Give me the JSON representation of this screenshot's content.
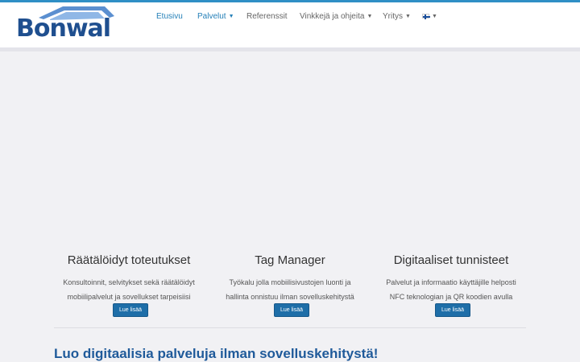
{
  "brand": {
    "logo_text": "Bonwal",
    "accent": "#2f8fc5",
    "logo_color": "#1f4f8f"
  },
  "nav": {
    "items": [
      {
        "label": "Etusivu",
        "active": true,
        "dropdown": false
      },
      {
        "label": "Palvelut",
        "active": true,
        "dropdown": true
      },
      {
        "label": "Referenssit",
        "active": false,
        "dropdown": false
      },
      {
        "label": "Vinkkejä ja ohjeita",
        "active": false,
        "dropdown": true
      },
      {
        "label": "Yritys",
        "active": false,
        "dropdown": true
      }
    ],
    "language": {
      "icon": "finnish-flag-icon",
      "dropdown": true
    }
  },
  "features": [
    {
      "title": "Räätälöidyt toteutukset",
      "line1": "Konsultoinnit, selvitykset sekä räätälöidyt",
      "line2": "mobiilipalvelut ja sovellukset tarpeisiisi",
      "button": "Lue lisää"
    },
    {
      "title": "Tag Manager",
      "line1": "Työkalu jolla mobiilisivustojen luonti ja",
      "line2": "hallinta onnistuu ilman sovelluskehitystä",
      "button": "Lue lisää"
    },
    {
      "title": "Digitaaliset tunnisteet",
      "line1": "Palvelut ja informaatio käyttäjille helposti",
      "line2": "NFC teknologian ja QR koodien avulla",
      "button": "Lue lisää"
    }
  ],
  "headline": "Luo digitaalisia palveluja ilman sovelluskehitystä!"
}
